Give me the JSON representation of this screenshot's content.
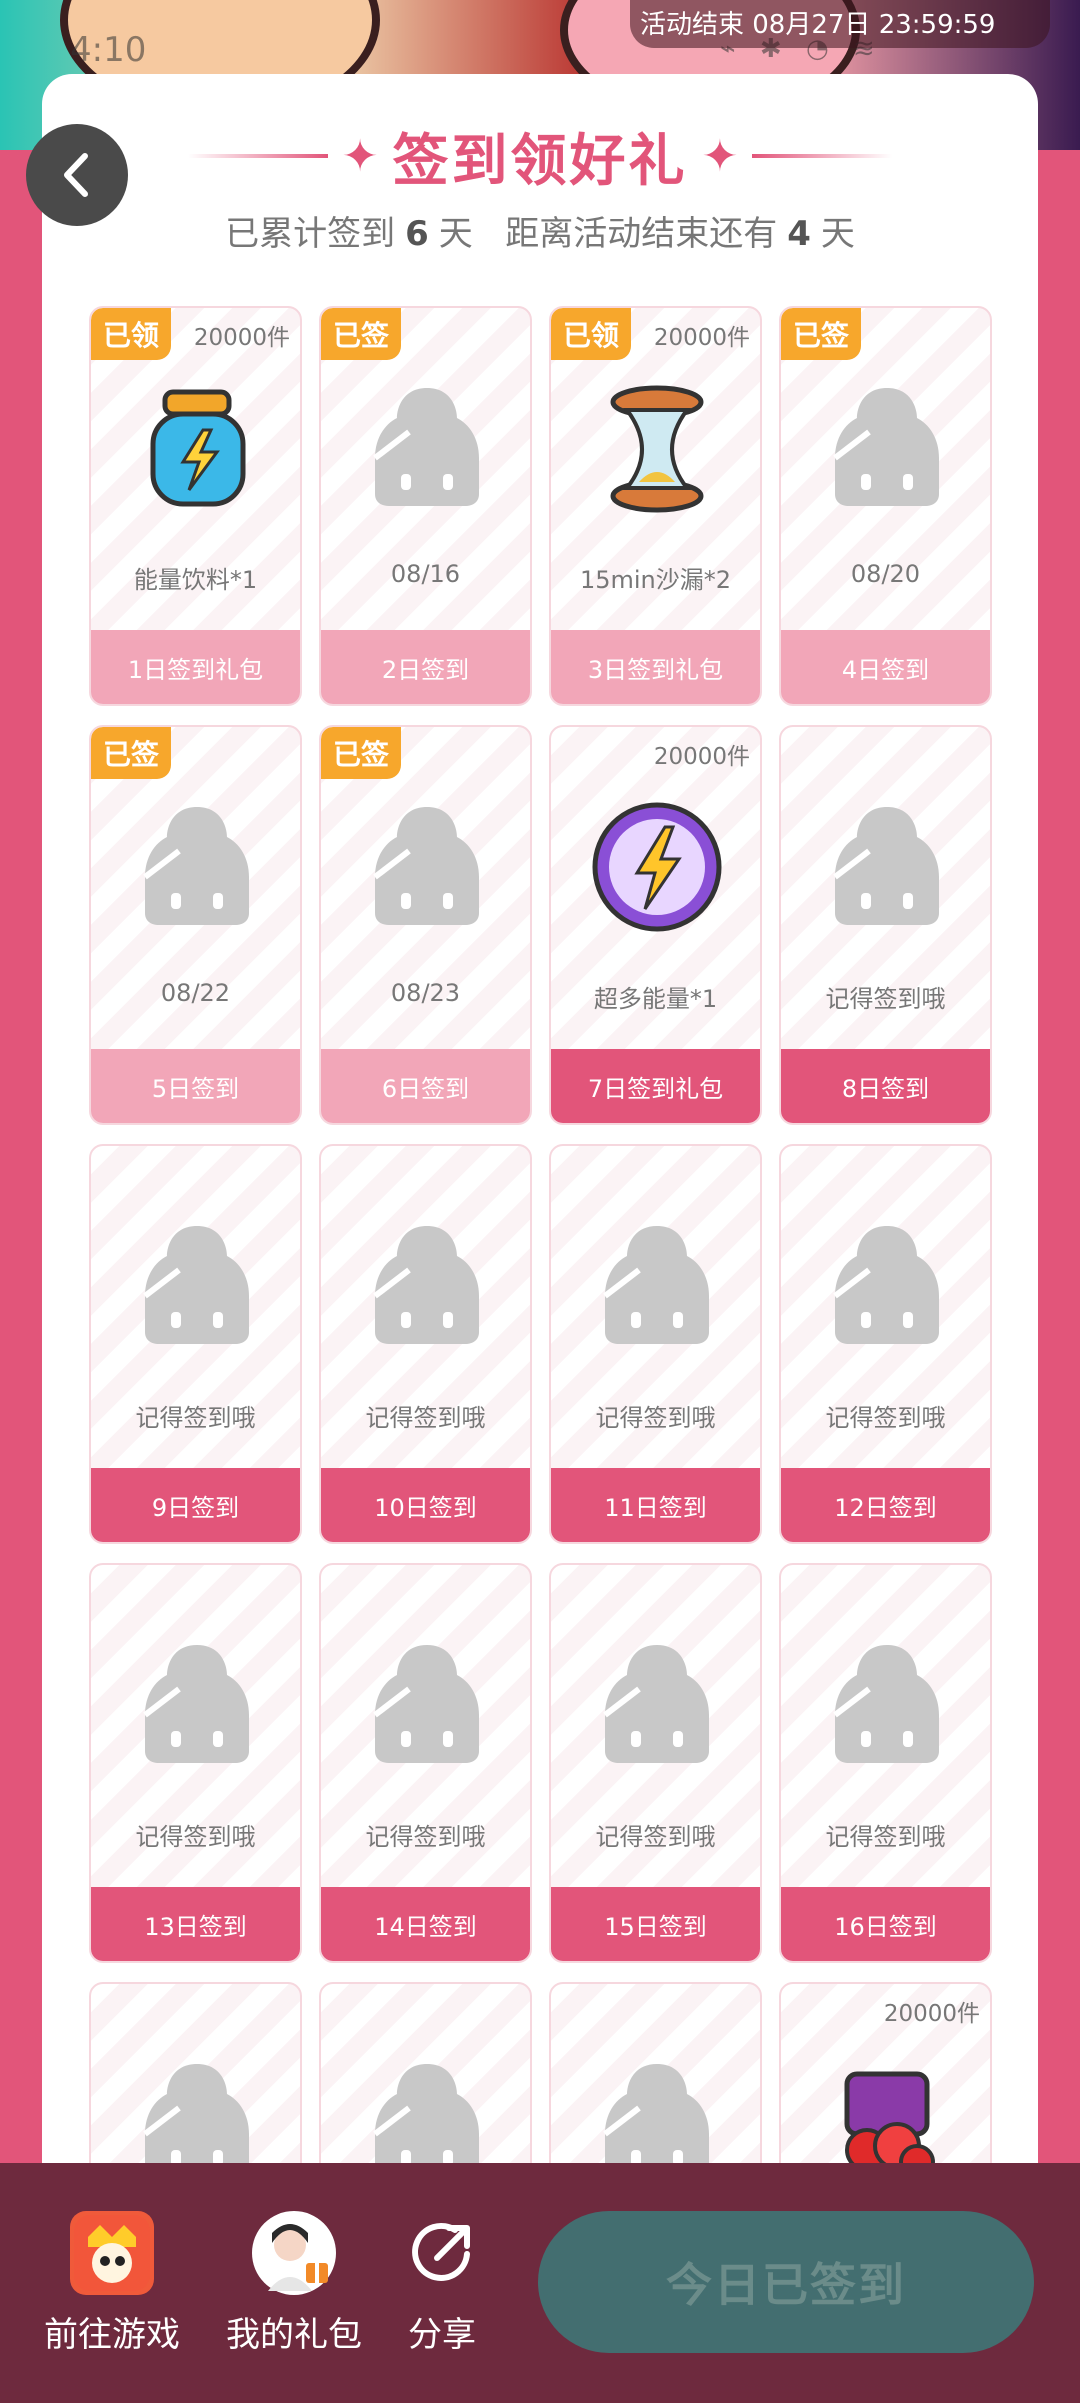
{
  "status": {
    "time": "4:10",
    "activity_end": "活动结束 08月27日 23:59:59"
  },
  "header": {
    "title": "签到领好礼",
    "subtitle_prefix": "已累计签到",
    "days_signed": "6",
    "unit": "天",
    "subtitle_middle": "距离活动结束还有",
    "days_left": "4",
    "unit2": "天"
  },
  "tiles": [
    {
      "badge": "已领",
      "count": "20000件",
      "art": "energy-drink-icon",
      "caption": "能量饮料*1",
      "footer": "1日签到礼包",
      "done": true
    },
    {
      "badge": "已签",
      "count": "",
      "art": "placeholder-icon",
      "caption": "08/16",
      "footer": "2日签到",
      "done": true
    },
    {
      "badge": "已领",
      "count": "20000件",
      "art": "hourglass-icon",
      "caption": "15min沙漏*2",
      "footer": "3日签到礼包",
      "done": true
    },
    {
      "badge": "已签",
      "count": "",
      "art": "placeholder-icon",
      "caption": "08/20",
      "footer": "4日签到",
      "done": true
    },
    {
      "badge": "已签",
      "count": "",
      "art": "placeholder-icon",
      "caption": "08/22",
      "footer": "5日签到",
      "done": true
    },
    {
      "badge": "已签",
      "count": "",
      "art": "placeholder-icon",
      "caption": "08/23",
      "footer": "6日签到",
      "done": true
    },
    {
      "badge": "",
      "count": "20000件",
      "art": "super-energy-icon",
      "caption": "超多能量*1",
      "footer": "7日签到礼包",
      "done": false
    },
    {
      "badge": "",
      "count": "",
      "art": "placeholder-icon",
      "caption": "记得签到哦",
      "footer": "8日签到",
      "done": false
    },
    {
      "badge": "",
      "count": "",
      "art": "placeholder-icon",
      "caption": "记得签到哦",
      "footer": "9日签到",
      "done": false
    },
    {
      "badge": "",
      "count": "",
      "art": "placeholder-icon",
      "caption": "记得签到哦",
      "footer": "10日签到",
      "done": false
    },
    {
      "badge": "",
      "count": "",
      "art": "placeholder-icon",
      "caption": "记得签到哦",
      "footer": "11日签到",
      "done": false
    },
    {
      "badge": "",
      "count": "",
      "art": "placeholder-icon",
      "caption": "记得签到哦",
      "footer": "12日签到",
      "done": false
    },
    {
      "badge": "",
      "count": "",
      "art": "placeholder-icon",
      "caption": "记得签到哦",
      "footer": "13日签到",
      "done": false
    },
    {
      "badge": "",
      "count": "",
      "art": "placeholder-icon",
      "caption": "记得签到哦",
      "footer": "14日签到",
      "done": false
    },
    {
      "badge": "",
      "count": "",
      "art": "placeholder-icon",
      "caption": "记得签到哦",
      "footer": "15日签到",
      "done": false
    },
    {
      "badge": "",
      "count": "",
      "art": "placeholder-icon",
      "caption": "记得签到哦",
      "footer": "16日签到",
      "done": false
    },
    {
      "badge": "",
      "count": "",
      "art": "placeholder-icon",
      "caption": "",
      "footer": "",
      "done": false
    },
    {
      "badge": "",
      "count": "",
      "art": "placeholder-icon",
      "caption": "",
      "footer": "",
      "done": false
    },
    {
      "badge": "",
      "count": "",
      "art": "placeholder-icon",
      "caption": "",
      "footer": "",
      "done": false
    },
    {
      "badge": "",
      "count": "20000件",
      "art": "gem-pack-icon",
      "caption": "",
      "footer": "",
      "done": false
    }
  ],
  "bottom_bar": {
    "goto_game": "前往游戏",
    "my_gifts": "我的礼包",
    "share": "分享",
    "checkin_button": "今日已签到"
  },
  "colors": {
    "accent": "#e2557a",
    "badge": "#f7a72c",
    "bottom_bar": "#6e2a3e",
    "checkin_button": "#436e70"
  }
}
